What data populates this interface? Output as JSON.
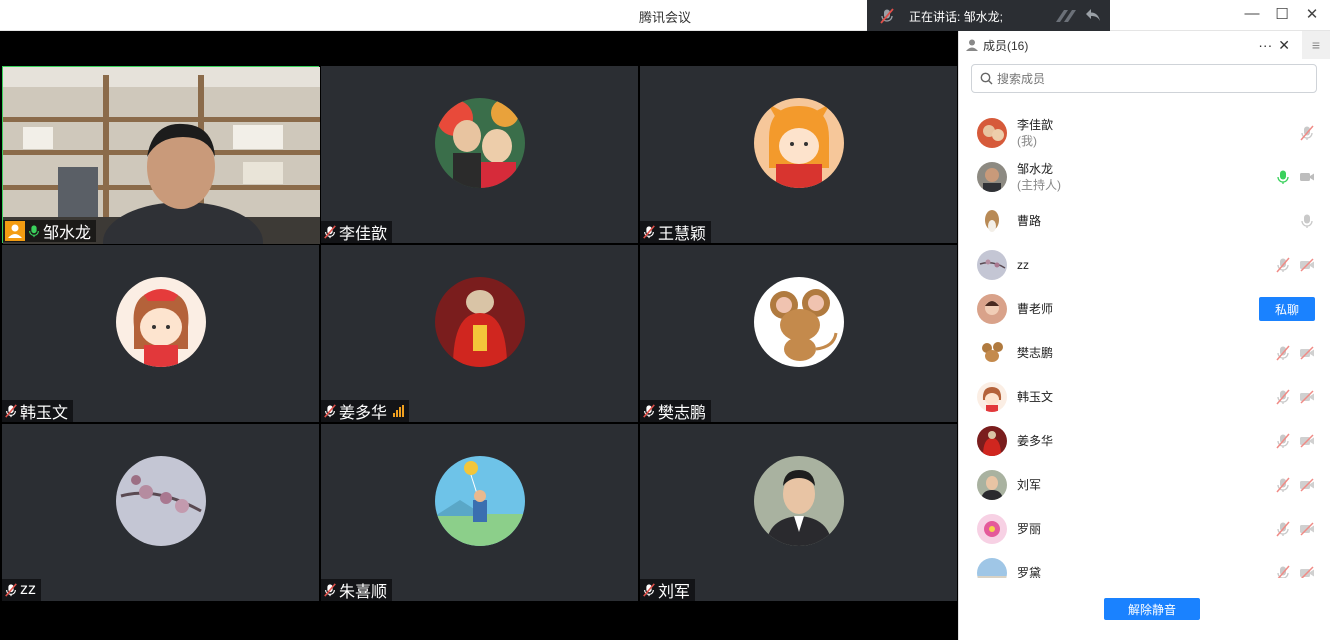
{
  "window": {
    "title": "腾讯会议",
    "speaking_label": "正在讲话: 邹水龙;",
    "controls": {
      "minimize": "—",
      "maximize": "☐",
      "close": "✕"
    }
  },
  "tiles": [
    {
      "name": "邹水龙",
      "is_host_video": true
    },
    {
      "name": "李佳歆"
    },
    {
      "name": "王慧颖"
    },
    {
      "name": "韩玉文"
    },
    {
      "name": "姜多华",
      "speaking_signal": true
    },
    {
      "name": "樊志鹏"
    },
    {
      "name": "zz"
    },
    {
      "name": "朱喜顺"
    },
    {
      "name": "刘军"
    }
  ],
  "panel": {
    "header": "成员(16)",
    "more": "···",
    "close": "✕",
    "menu": "≡",
    "search_placeholder": "搜索成员",
    "members": [
      {
        "name": "李佳歆",
        "role": "(我)",
        "mic": "muted",
        "cam": "none"
      },
      {
        "name": "邹水龙",
        "role": "(主持人)",
        "mic": "active",
        "cam": "off-grey"
      },
      {
        "name": "曹路",
        "role": "",
        "mic": "grey",
        "cam": "none"
      },
      {
        "name": "zz",
        "role": "",
        "mic": "muted",
        "cam": "muted"
      },
      {
        "name": "曹老师",
        "role": "",
        "chat_button": "私聊"
      },
      {
        "name": "樊志鹏",
        "role": "",
        "mic": "muted",
        "cam": "muted"
      },
      {
        "name": "韩玉文",
        "role": "",
        "mic": "muted",
        "cam": "muted"
      },
      {
        "name": "姜多华",
        "role": "",
        "mic": "muted",
        "cam": "muted"
      },
      {
        "name": "刘军",
        "role": "",
        "mic": "muted",
        "cam": "muted"
      },
      {
        "name": "罗丽",
        "role": "",
        "mic": "muted",
        "cam": "muted"
      },
      {
        "name": "罗黛",
        "role": "",
        "mic": "muted",
        "cam": "muted"
      }
    ],
    "unmute_button": "解除静音"
  },
  "colors": {
    "accent": "#1a82ff",
    "tile_bg": "#2b2e33",
    "muted_red": "#e0504a",
    "active_green": "#3ad15c"
  }
}
